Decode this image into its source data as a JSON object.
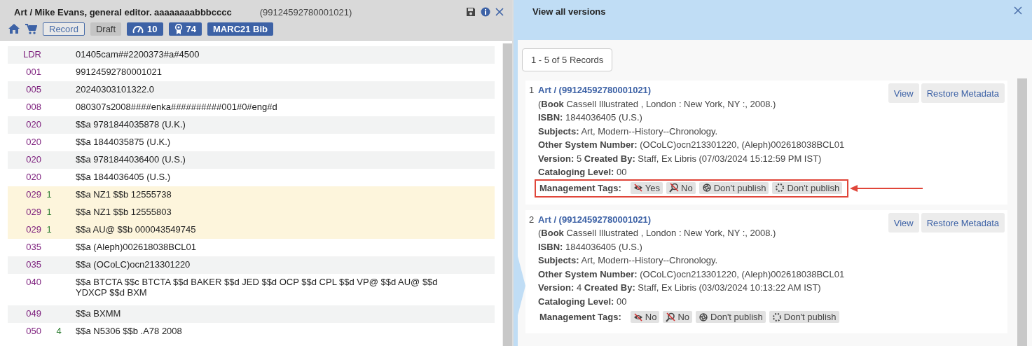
{
  "editor": {
    "title": "Art / Mike Evans, general editor. aaaaaaaabbbcccc",
    "record_id": "(99124592780001021)",
    "badges": [
      {
        "kind": "outline",
        "text": "Record"
      },
      {
        "kind": "plain",
        "text": "Draft"
      },
      {
        "kind": "speed",
        "text": "10"
      },
      {
        "kind": "score",
        "text": "74"
      },
      {
        "kind": "blue",
        "text": "MARC21 Bib"
      }
    ],
    "fields": [
      {
        "tag": "LDR",
        "content": "01405cam##2200373#a#4500",
        "highlighted": false
      },
      {
        "tag": "001",
        "content": "99124592780001021",
        "highlighted": false
      },
      {
        "tag": "005",
        "content": "20240303101322.0",
        "highlighted": false
      },
      {
        "tag": "008",
        "content": "080307s2008####enka##########001#0#eng#d",
        "highlighted": false
      },
      {
        "tag": "020",
        "content": "$$a 9781844035878 (U.K.)",
        "highlighted": false
      },
      {
        "tag": "020",
        "content": "$$a 1844035875 (U.K.)",
        "highlighted": false
      },
      {
        "tag": "020",
        "content": "$$a 9781844036400 (U.S.)",
        "highlighted": false
      },
      {
        "tag": "020",
        "content": "$$a 1844036405 (U.S.)",
        "highlighted": false
      },
      {
        "tag": "029",
        "ind1": "1",
        "content": "$$a NZ1 $$b 12555738",
        "highlighted": true
      },
      {
        "tag": "029",
        "ind1": "1",
        "content": "$$a NZ1 $$b 12555803",
        "highlighted": true
      },
      {
        "tag": "029",
        "ind1": "1",
        "content": "$$a AU@ $$b 000043549745",
        "highlighted": true
      },
      {
        "tag": "035",
        "content": "$$a (Aleph)002618038BCL01",
        "highlighted": false
      },
      {
        "tag": "035",
        "content": "$$a (OCoLC)ocn213301220",
        "highlighted": false
      },
      {
        "tag": "040",
        "content": "$$a BTCTA $$c BTCTA $$d BAKER $$d JED $$d OCP $$d CPL $$d VP@ $$d AU@ $$d YDXCP $$d BXM",
        "highlighted": false
      },
      {
        "tag": "049",
        "content": "$$a BXMM",
        "highlighted": false
      },
      {
        "tag": "050",
        "ind2": "4",
        "content": "$$a N5306 $$b .A78 2008",
        "highlighted": false
      }
    ]
  },
  "versions_panel": {
    "title": "View all versions",
    "records_count": "1 - 5 of 5 Records",
    "versions": [
      {
        "number": "1",
        "title": "Art / (99124592780001021)",
        "buttons": [
          "View",
          "Restore Metadata"
        ],
        "lines": [
          "(**Book** Cassell Illustrated , London : New York, NY :, 2008.)",
          "**ISBN:** 1844036405 (U.S.)",
          "**Subjects:** Art, Modern--History--Chronology.",
          "**Other System Number:** (OCoLC)ocn213301220, (Aleph)002618038BCL01",
          "**Version:** 5 **Created By:** Staff, Ex Libris (07/03/2024 15:12:59 PM IST)",
          "**Cataloging Level:** 00"
        ],
        "tags_label": "Management Tags:",
        "highlighted": true,
        "tags": [
          {
            "kind": "suppressed",
            "text": "Yes"
          },
          {
            "kind": "discovery",
            "text": "No"
          },
          {
            "kind": "publishing",
            "text": "Don't publish"
          },
          {
            "kind": "sync",
            "text": "Don't publish"
          }
        ]
      },
      {
        "number": "2",
        "title": "Art / (99124592780001021)",
        "buttons": [
          "View",
          "Restore Metadata"
        ],
        "lines": [
          "(**Book** Cassell Illustrated , London : New York, NY :, 2008.)",
          "**ISBN:** 1844036405 (U.S.)",
          "**Subjects:** Art, Modern--History--Chronology.",
          "**Other System Number:** (OCoLC)ocn213301220, (Aleph)002618038BCL01",
          "**Version:** 4 **Created By:** Staff, Ex Libris (03/03/2024 10:13:22 AM IST)",
          "**Cataloging Level:** 00"
        ],
        "tags_label": "Management Tags:",
        "highlighted": false,
        "tags": [
          {
            "kind": "suppressed",
            "text": "No"
          },
          {
            "kind": "discovery",
            "text": "No"
          },
          {
            "kind": "publishing",
            "text": "Don't publish"
          },
          {
            "kind": "sync",
            "text": "Don't publish"
          }
        ]
      }
    ]
  }
}
